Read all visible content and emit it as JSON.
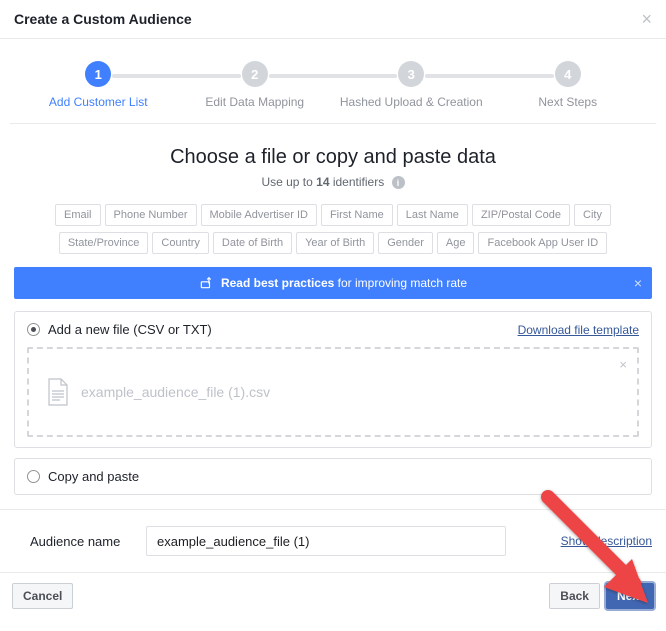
{
  "header": {
    "title": "Create a Custom Audience"
  },
  "stepper": {
    "items": [
      {
        "num": "1",
        "label": "Add Customer List"
      },
      {
        "num": "2",
        "label": "Edit Data Mapping"
      },
      {
        "num": "3",
        "label": "Hashed Upload & Creation"
      },
      {
        "num": "4",
        "label": "Next Steps"
      }
    ]
  },
  "main": {
    "title": "Choose a file or copy and paste data",
    "subtitle_pre": "Use up to ",
    "subtitle_bold": "14",
    "subtitle_post": " identifiers",
    "chips": [
      "Email",
      "Phone Number",
      "Mobile Advertiser ID",
      "First Name",
      "Last Name",
      "ZIP/Postal Code",
      "City",
      "State/Province",
      "Country",
      "Date of Birth",
      "Year of Birth",
      "Gender",
      "Age",
      "Facebook App User ID"
    ],
    "banner_bold": "Read best practices",
    "banner_rest": " for improving match rate",
    "option_file_label": "Add a new file (CSV or TXT)",
    "download_template": "Download file template",
    "filename": "example_audience_file (1).csv",
    "option_paste_label": "Copy and paste"
  },
  "name": {
    "label": "Audience name",
    "value": "example_audience_file (1)",
    "show_desc": "Show description"
  },
  "footer": {
    "cancel": "Cancel",
    "back": "Back",
    "next": "Next"
  }
}
